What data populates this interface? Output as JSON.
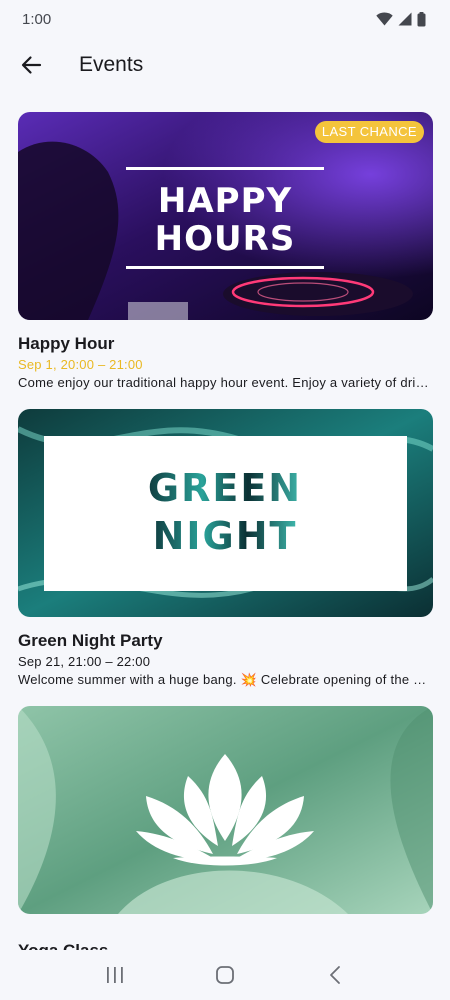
{
  "status_bar": {
    "time": "1:00",
    "icons": [
      "wifi-icon",
      "signal-icon",
      "battery-icon"
    ]
  },
  "app_bar": {
    "back_icon": "arrow-left-icon",
    "title": "Events"
  },
  "events": [
    {
      "title": "Happy Hour",
      "date": "Sep 1, 20:00 – 21:00",
      "date_highlighted": true,
      "description": "Come enjoy our traditional happy hour event. Enjoy a variety of drinks and snacks.",
      "badge": "LAST CHANCE",
      "image_text": [
        "HAPPY",
        "HOURS"
      ]
    },
    {
      "title": "Green Night Party",
      "date": "Sep 21, 21:00 – 22:00",
      "date_highlighted": false,
      "description": "Welcome summer with a huge bang. 💥  Celebrate opening of the season with us.",
      "image_text": [
        "GREEN",
        "NIGHT"
      ]
    },
    {
      "title": "Yoga Class",
      "image_icon": "lotus-icon"
    }
  ],
  "nav_bar": {
    "items": [
      "recents-icon",
      "home-icon",
      "back-icon"
    ]
  },
  "colors": {
    "background": "#f6f7fb",
    "highlight_date": "#e9b923",
    "badge": "#f4c43c"
  }
}
